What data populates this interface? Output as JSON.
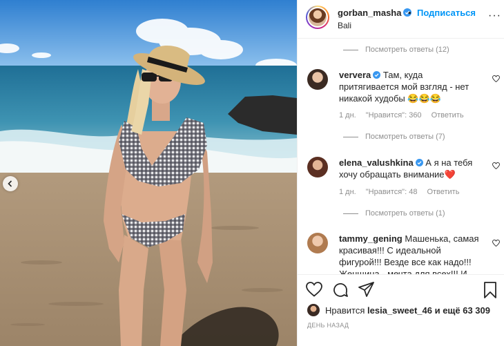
{
  "header": {
    "username": "gorban_masha",
    "separator": "•",
    "follow_label": "Подписаться",
    "location": "Bali",
    "more_label": "···"
  },
  "comments": [
    {
      "type": "replies",
      "label": "Посмотреть ответы (12)"
    },
    {
      "type": "comment",
      "username": "ververa",
      "verified": true,
      "text": "Там, куда притягивается мой взгляд - нет никакой худобы 😂😂😂",
      "time": "1 дн.",
      "likes": "\"Нравится\": 360",
      "reply_label": "Ответить"
    },
    {
      "type": "replies",
      "label": "Посмотреть ответы (7)"
    },
    {
      "type": "comment",
      "username": "elena_valushkina",
      "verified": true,
      "text": "А я на тебя хочу обращать внимание❤️",
      "time": "1 дн.",
      "likes": "\"Нравится\": 48",
      "reply_label": "Ответить"
    },
    {
      "type": "replies",
      "label": "Посмотреть ответы (1)"
    },
    {
      "type": "comment",
      "username": "tammy_gening",
      "verified": false,
      "text": "Машенька, самая красивая!!! С идеальной фигурой!!! Везде все как надо!!! Женщина - мечта для всех!!! И"
    }
  ],
  "likes": {
    "prefix": "Нравится",
    "user": "lesia_sweet_46",
    "suffix": "и ещё 63 309"
  },
  "time_ago": "ДЕНЬ НАЗАД",
  "colors": {
    "accent": "#0095f6",
    "verified": "#3897f0",
    "heart": "#ed4956",
    "muted": "#8e8e8e"
  },
  "icons": [
    "heart-icon",
    "comment-icon",
    "share-icon",
    "bookmark-icon",
    "chevron-left-icon",
    "verified-badge-icon",
    "more-icon"
  ]
}
